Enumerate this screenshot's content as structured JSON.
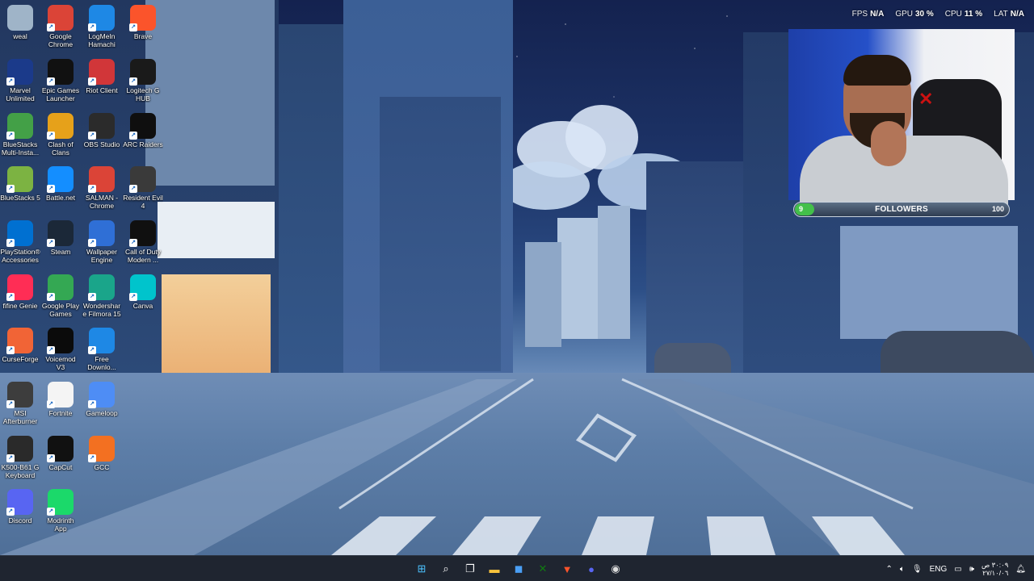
{
  "perf": {
    "fps_label": "FPS",
    "fps_value": "N/A",
    "gpu_label": "GPU",
    "gpu_value": "30 %",
    "cpu_label": "CPU",
    "cpu_value": "11 %",
    "lat_label": "LAT",
    "lat_value": "N/A"
  },
  "followers": {
    "current": "9",
    "title": "FOLLOWERS",
    "goal": "100",
    "progress_fraction": 0.09
  },
  "desktop_icons": [
    {
      "label": "weal",
      "icon": "recycle-bin-icon",
      "color": "#9fb4c8"
    },
    {
      "label": "Google Chrome",
      "icon": "chrome-icon",
      "color": "#db4437"
    },
    {
      "label": "LogMeIn Hamachi",
      "icon": "hamachi-icon",
      "color": "#1e88e5"
    },
    {
      "label": "Brave",
      "icon": "brave-icon",
      "color": "#fb542b"
    },
    {
      "label": "Marvel Unlimited",
      "icon": "marvel-icon",
      "color": "#1b3a8a"
    },
    {
      "label": "Epic Games Launcher",
      "icon": "epic-games-icon",
      "color": "#111111"
    },
    {
      "label": "Riot Client",
      "icon": "riot-icon",
      "color": "#d13639"
    },
    {
      "label": "Logitech G HUB",
      "icon": "logitech-icon",
      "color": "#1a1a1a"
    },
    {
      "label": "BlueStacks Multi-Insta...",
      "icon": "bluestacks-multi-icon",
      "color": "#43a047"
    },
    {
      "label": "Clash of Clans",
      "icon": "clash-of-clans-icon",
      "color": "#e6a11a"
    },
    {
      "label": "OBS Studio",
      "icon": "obs-icon",
      "color": "#2b2b2b"
    },
    {
      "label": "ARC Raiders",
      "icon": "arc-raiders-icon",
      "color": "#0f0f0f"
    },
    {
      "label": "BlueStacks 5",
      "icon": "bluestacks-icon",
      "color": "#7cb342"
    },
    {
      "label": "Battle.net",
      "icon": "battlenet-icon",
      "color": "#148eff"
    },
    {
      "label": "SALMAN - Chrome",
      "icon": "chrome-profile-icon",
      "color": "#db4437"
    },
    {
      "label": "Resident Evil 4",
      "icon": "resident-evil-icon",
      "color": "#3a3a3a"
    },
    {
      "label": "PlayStation® Accessories",
      "icon": "playstation-icon",
      "color": "#0070d1"
    },
    {
      "label": "Steam",
      "icon": "steam-icon",
      "color": "#1b2838"
    },
    {
      "label": "Wallpaper Engine",
      "icon": "wallpaper-engine-icon",
      "color": "#2f6fd6"
    },
    {
      "label": "Call of Duty Modern ...",
      "icon": "cod-icon",
      "color": "#101010"
    },
    {
      "label": "fifine Genie",
      "icon": "fifine-icon",
      "color": "#ff2d55"
    },
    {
      "label": "Google Play Games",
      "icon": "play-games-icon",
      "color": "#34a853"
    },
    {
      "label": "Wondershare Filmora 15",
      "icon": "filmora-icon",
      "color": "#1aa58a"
    },
    {
      "label": "Canva",
      "icon": "canva-icon",
      "color": "#00c4cc"
    },
    {
      "label": "CurseForge",
      "icon": "curseforge-icon",
      "color": "#f16436"
    },
    {
      "label": "Voicemod V3",
      "icon": "voicemod-icon",
      "color": "#0b0b0b"
    },
    {
      "label": "Free Downlo...",
      "icon": "free-download-icon",
      "color": "#1e88e5"
    },
    {
      "label": "MSI Afterburner",
      "icon": "afterburner-icon",
      "color": "#3d3d3d"
    },
    {
      "label": "Fortnite",
      "icon": "file-icon",
      "color": "#f4f4f4"
    },
    {
      "label": "Gameloop",
      "icon": "gameloop-icon",
      "color": "#4e8df5"
    },
    {
      "label": "K500-B61 G Keyboard",
      "icon": "keyboard-icon",
      "color": "#2a2a2a"
    },
    {
      "label": "CapCut",
      "icon": "capcut-icon",
      "color": "#111111"
    },
    {
      "label": "GCC",
      "icon": "gcc-icon",
      "color": "#f37021"
    },
    {
      "label": "Discord",
      "icon": "discord-icon",
      "color": "#5865f2"
    },
    {
      "label": "Modrinth App",
      "icon": "modrinth-icon",
      "color": "#1bd96a"
    }
  ],
  "taskbar": {
    "apps": [
      {
        "name": "start",
        "icon": "windows-icon",
        "glyph": "⊞",
        "color": "#4cc2ff"
      },
      {
        "name": "search",
        "icon": "search-icon",
        "glyph": "⌕",
        "color": "#ffffff"
      },
      {
        "name": "task-view",
        "icon": "task-view-icon",
        "glyph": "❐",
        "color": "#ffffff"
      },
      {
        "name": "file-explorer",
        "icon": "folder-icon",
        "glyph": "▬",
        "color": "#f8c33c"
      },
      {
        "name": "store",
        "icon": "store-icon",
        "glyph": "◼",
        "color": "#4a9ff5"
      },
      {
        "name": "xbox",
        "icon": "xbox-icon",
        "glyph": "✕",
        "color": "#107c10"
      },
      {
        "name": "brave",
        "icon": "brave-icon",
        "glyph": "▼",
        "color": "#fb542b"
      },
      {
        "name": "discord",
        "icon": "discord-icon",
        "glyph": "●",
        "color": "#5865f2"
      },
      {
        "name": "obs",
        "icon": "obs-icon",
        "glyph": "◉",
        "color": "#dddddd"
      }
    ],
    "tray": {
      "language": "ENG",
      "time": "٣٠:٠٩ ص",
      "date": "٢٧/١٠/٠٦"
    }
  }
}
